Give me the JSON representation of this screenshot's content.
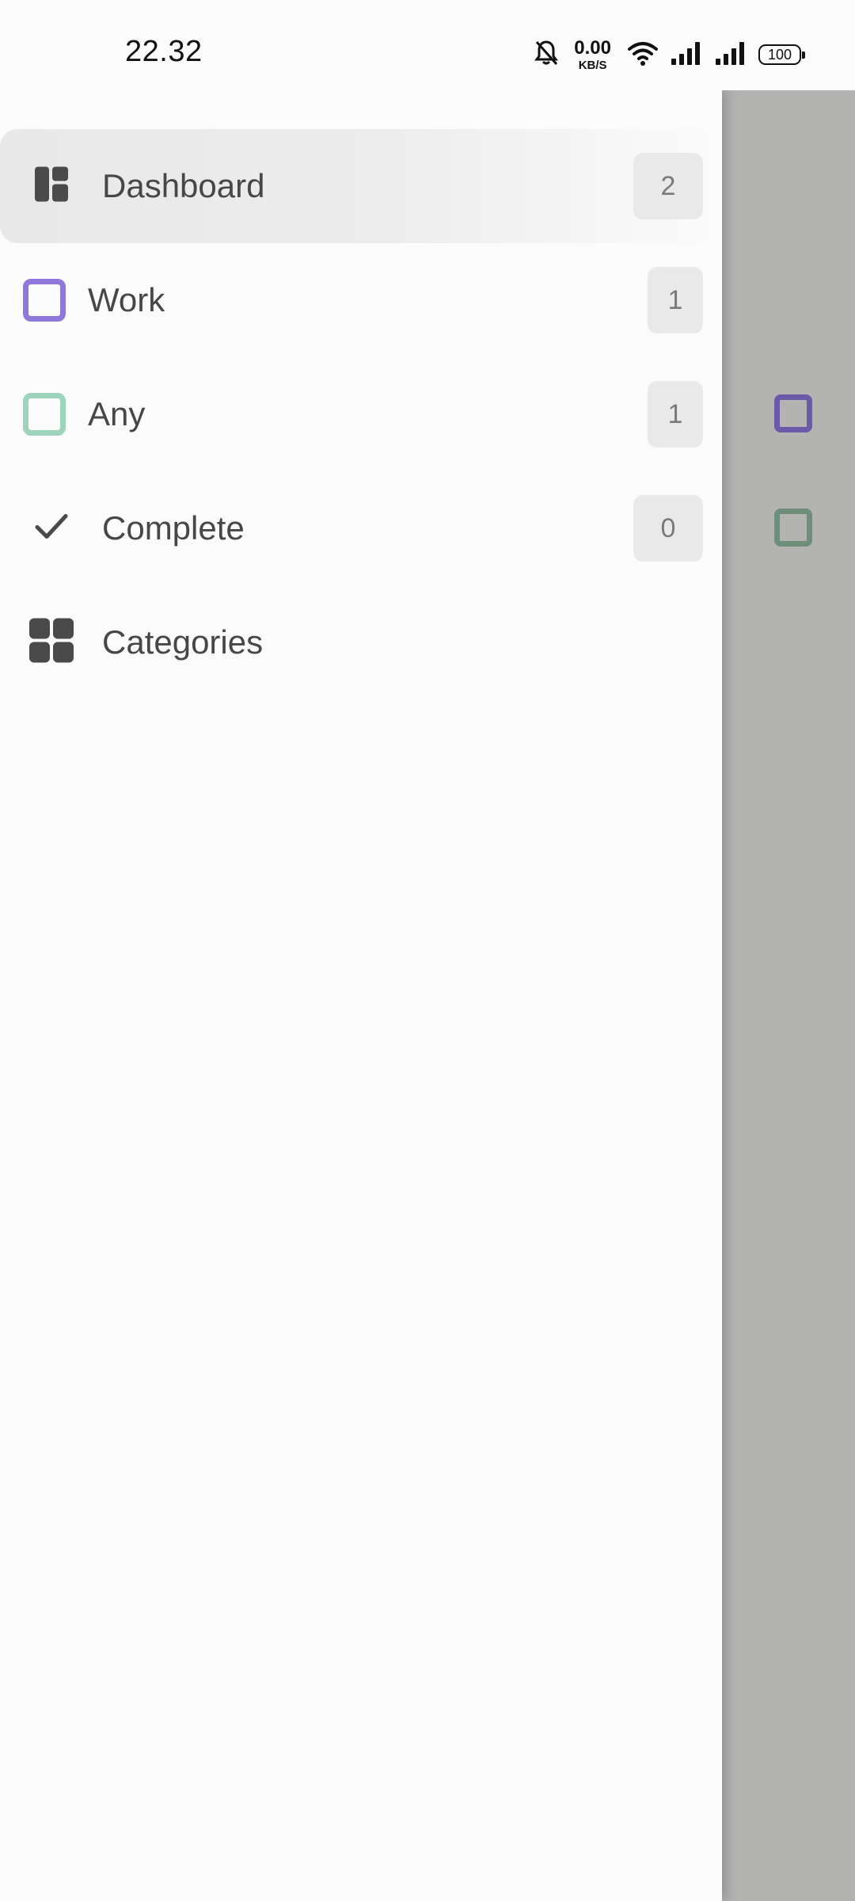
{
  "status_bar": {
    "time": "22.32",
    "net_speed_value": "0.00",
    "net_speed_unit": "KB/S",
    "battery": "100"
  },
  "drawer": {
    "items": [
      {
        "label": "Dashboard",
        "count": "2",
        "icon": "dashboard-icon",
        "active": true
      },
      {
        "label": "Work",
        "count": "1",
        "icon": "category-square-icon",
        "color": "#8f78db"
      },
      {
        "label": "Any",
        "count": "1",
        "icon": "category-square-icon",
        "color": "#9ed3bc"
      },
      {
        "label": "Complete",
        "count": "0",
        "icon": "checkmark-icon"
      },
      {
        "label": "Categories",
        "icon": "grid-icon"
      }
    ]
  },
  "background_list": {
    "checkbox_colors": [
      "#6b5aa8",
      "#6e8e7c"
    ]
  }
}
